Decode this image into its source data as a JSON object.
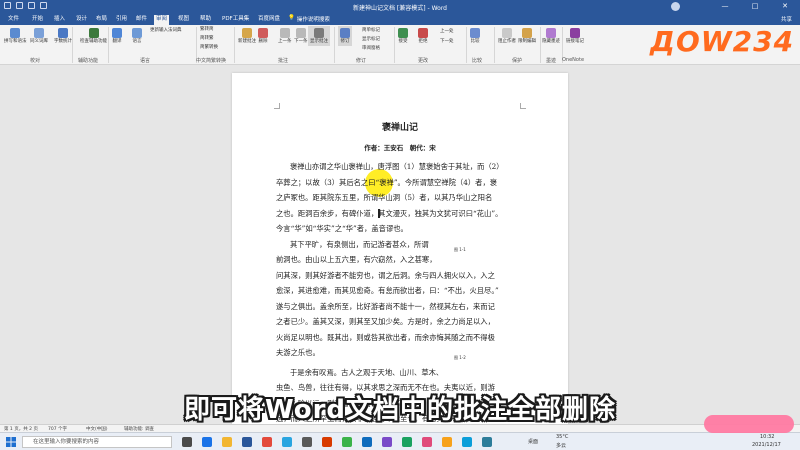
{
  "window": {
    "title": "新建神山记文档 [兼容模式] - Word",
    "share_label": "共享",
    "min": "—",
    "max": "□",
    "close": "✕"
  },
  "tabs": [
    "文件",
    "开始",
    "插入",
    "设计",
    "布局",
    "引用",
    "邮件",
    "审阅",
    "视图",
    "帮助",
    "PDF工具集",
    "百度网盘"
  ],
  "active_tab": "审阅",
  "search_hint": "操作说明搜索",
  "ribbon": {
    "buttons": [
      "拼写和语法",
      "同义词库",
      "字数统计",
      "检查辅助功能",
      "翻译",
      "语言",
      "更新输入法词典",
      "繁转简",
      "简转繁",
      "简繁转换",
      "新建批注",
      "删除",
      "上一条",
      "下一条",
      "显示批注",
      "修订",
      "简单标记",
      "显示标记",
      "审阅窗格",
      "接受",
      "拒绝",
      "上一处",
      "下一处",
      "比较",
      "阻止作者",
      "限制编辑",
      "隐藏墨迹",
      "链接笔记"
    ],
    "groups": [
      "校对",
      "辅助功能",
      "语言",
      "中文简繁转换",
      "批注",
      "修订",
      "更改",
      "比较",
      "保护",
      "墨迹",
      "OneNote"
    ]
  },
  "brand_watermark": "ДOW234",
  "document": {
    "title": "褒禅山记",
    "byline": "作者：王安石　朝代：宋",
    "paragraphs": [
      "褒禅山亦谓之华山褒禅山，唐浮图（1）慧褒始舍于其址，而（2）卒葬之；以故（3）其后名之曰“褒禅”。今所谓慧空禅院（4）者，褒之庐冢也。距其院东五里，所谓华山洞（5）者，以其乃华山之阳名之也。距洞百余步，有碑仆道，其文漫灭，独其为文犹可识曰“花山”。今言“华”如“华实”之“华”者，盖音谬也。",
      "其下平旷，有泉侧出，而记游者甚众，所谓前洞也。由山以上五六里，有穴窈然，入之甚寒，问其深，则其好游者不能穷也，谓之后洞。余与四人拥火以入，入之愈深，其进愈难，而其见愈奇。有怠而欲出者，曰：“不出，火且尽。”遂与之俱出。盖余所至，比好游者尚不能十一，然视其左右，来而记之者已少。盖其又深，则其至又加少矣。方是时，余之力尚足以入，火尚足以明也。既其出，则或咎其欲出者，而余亦悔其随之而不得极夫游之乐也。",
      "于是余有叹焉。古人之观于天地、山川、草木、虫鱼、鸟兽，往往有得，以其求思之深而无不在也。夫夷以近，则游者众；险以远，则至者少。而世之奇伟、瑰怪，非常之观，常在于险远，而人之所罕至焉，故非有志者不能至也。有志矣，不随以止也，然力不足者，亦不能至也。有志与力，而又不随以怠，至于幽暗昏惑而无物以相之，亦不能至也。"
    ],
    "lines": [
      "褒禅山亦谓之华山褒禅山，唐浮图（1）慧褒始舍于其址，而（2）",
      "卒葬之；以故（3）其后名之曰“褒禅”。今所谓慧空禅院（4）者，褒",
      "之庐冢也。距其院东五里，所谓华山洞（5）者，以其乃华山之阳名",
      "之也。距洞百余步，有碑仆道，其文漫灭，独其为文犹可识曰“花山”。",
      "今言“华”如“华实”之“华”者，盖音谬也。",
      "其下平旷，有泉侧出，而记游者甚众，所谓",
      "前洞也。由山以上五六里，有穴窈然，入之甚寒，",
      "问其深，则其好游者不能穷也，谓之后洞。余与四人拥火以入，入之",
      "愈深，其进愈难，而其见愈奇。有怠而欲出者，曰：“不出，火且尽。”",
      "遂与之俱出。盖余所至，比好游者尚不能十一，然视其左右，来而记",
      "之者已少。盖其又深，则其至又加少矣。方是时，余之力尚足以入，",
      "火尚足以明也。既其出，则或咎其欲出者，而余亦悔其随之而不得极",
      "夫游之乐也。",
      "于是余有叹焉。古人之观于天地、山川、草木、",
      "虫鱼、鸟兽，往往有得，以其求思之深而无不在也。夫夷以近，则游",
      "者众；险以远，则至者少。而世之奇伟、瑰怪，非常之观，常在于险",
      "远，而人之所罕至焉，故非有志者不能至也。有志矣，不随以止也，"
    ],
    "figure_marks": [
      "图 1-1",
      "图 1-2"
    ]
  },
  "subtitle": "即可将Word文档中的批注全部删除",
  "status": {
    "page": "第 1 页，共 2 页",
    "words": "707 个字",
    "lang": "中文(中国)",
    "accessibility": "辅助功能: 调查"
  },
  "taskbar": {
    "search_placeholder": "在这里输入你要搜索的内容",
    "weather": "35°C",
    "weather_desc": "多云",
    "time": "10:32",
    "date": "2021/12/17",
    "desktop": "桌面"
  },
  "colors": {
    "word_blue": "#2b579a",
    "highlight": "#ffea00",
    "watermark": "#ff6a1e"
  }
}
